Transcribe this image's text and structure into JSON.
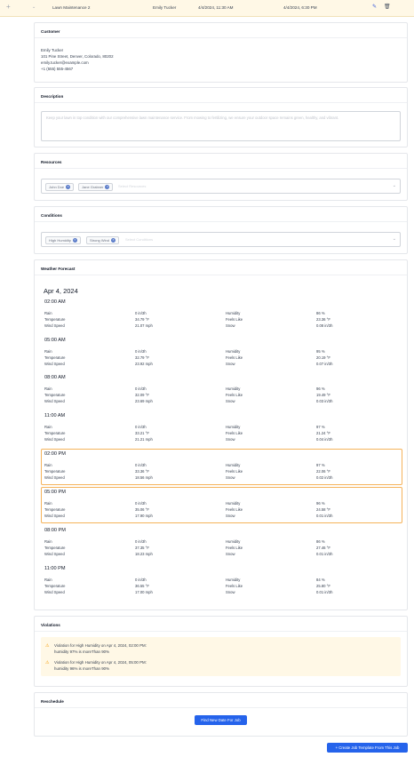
{
  "task_row": {
    "name": "Lawn Maintenance 2",
    "assignee": "Emily Tucker",
    "start": "4/4/2024, 11:30 AM",
    "end": "4/4/2024, 6:30 PM"
  },
  "customer": {
    "title": "Customer",
    "name": "Emily Tucker",
    "address": "101 Pine Street, Denver, Colorado, 80202",
    "email": "emily.tucker@example.com",
    "phone": "+1 (555) 555-4567"
  },
  "description": {
    "title": "Description",
    "placeholder": "Keep your lawn in top condition with our comprehensive lawn maintenance service. From mowing to fertilizing, we ensure your outdoor space remains green, healthy, and vibrant."
  },
  "resources": {
    "title": "Resources",
    "chips": [
      "John Doe",
      "Jane Grabner"
    ],
    "placeholder": "Select Resources"
  },
  "conditions": {
    "title": "Conditions",
    "chips": [
      "High Humidity",
      "Strong Wind"
    ],
    "placeholder": "Select Conditions"
  },
  "weather": {
    "title": "Weather Forecast",
    "date": "Apr 4, 2024",
    "labels": {
      "rain": "Rain",
      "temperature": "Temperature",
      "wind": "Wind Speed",
      "humidity": "Humidity",
      "feels": "Feels Like",
      "snow": "Snow"
    },
    "blocks": [
      {
        "time": "02:00 AM",
        "rain": "0 in/3h",
        "temp": "34.79 °F",
        "wind": "21.07 mph",
        "humidity": "86 %",
        "feels": "23.36 °F",
        "snow": "0.08 in/3h",
        "highlight": false
      },
      {
        "time": "05:00 AM",
        "rain": "0 in/3h",
        "temp": "32.79 °F",
        "wind": "23.92 mph",
        "humidity": "95 %",
        "feels": "20.19 °F",
        "snow": "0.07 in/3h",
        "highlight": false
      },
      {
        "time": "08:00 AM",
        "rain": "0 in/3h",
        "temp": "32.09 °F",
        "wind": "23.69 mph",
        "humidity": "96 %",
        "feels": "19.49 °F",
        "snow": "0.03 in/3h",
        "highlight": false
      },
      {
        "time": "11:00 AM",
        "rain": "0 in/3h",
        "temp": "33.21 °F",
        "wind": "21.21 mph",
        "humidity": "97 %",
        "feels": "21.24 °F",
        "snow": "0.04 in/3h",
        "highlight": false
      },
      {
        "time": "02:00 PM",
        "rain": "0 in/3h",
        "temp": "33.36 °F",
        "wind": "18.56 mph",
        "humidity": "97 %",
        "feels": "22.06 °F",
        "snow": "0.02 in/3h",
        "highlight": true
      },
      {
        "time": "05:00 PM",
        "rain": "0 in/3h",
        "temp": "35.06 °F",
        "wind": "17.90 mph",
        "humidity": "96 %",
        "feels": "24.58 °F",
        "snow": "0.01 in/3h",
        "highlight": true
      },
      {
        "time": "08:00 PM",
        "rain": "0 in/3h",
        "temp": "37.35 °F",
        "wind": "18.23 mph",
        "humidity": "86 %",
        "feels": "27.46 °F",
        "snow": "0.01 in/3h",
        "highlight": false
      },
      {
        "time": "11:00 PM",
        "rain": "0 in/3h",
        "temp": "36.55 °F",
        "wind": "17.00 mph",
        "humidity": "84 %",
        "feels": "25.80 °F",
        "snow": "0.01 in/3h",
        "highlight": false
      }
    ]
  },
  "violations": {
    "title": "Violations",
    "items": [
      {
        "headline": "Violation for High Humidity on Apr 4, 2024, 02:00 PM:",
        "detail": "humidity 97% is moreThan 90%"
      },
      {
        "headline": "Violation for High Humidity on Apr 4, 2024, 05:00 PM:",
        "detail": "humidity 96% is moreThan 90%"
      }
    ]
  },
  "reschedule": {
    "title": "Reschedule",
    "button": "Find New Date For Job"
  },
  "footer": {
    "create_button": "Create Job Template From This Job"
  },
  "colors": {
    "primary": "#2563eb",
    "highlight_border": "#f5b35a",
    "violation_bg": "#fff8e6",
    "warning": "#f59e0b"
  }
}
